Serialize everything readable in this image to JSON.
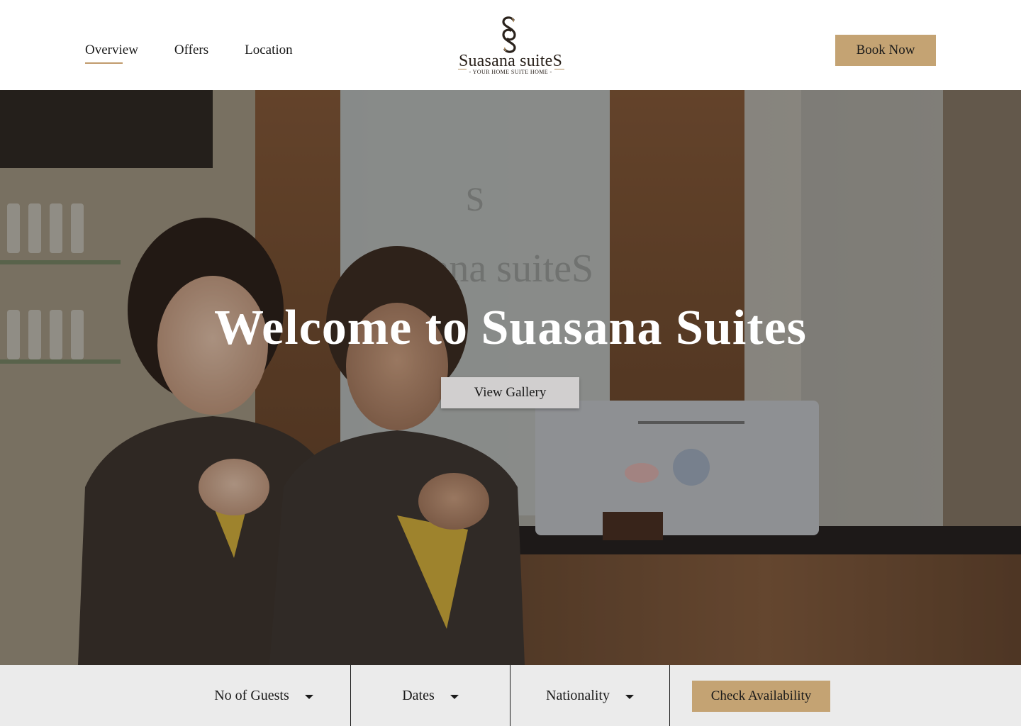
{
  "header": {
    "nav": [
      {
        "label": "Overview",
        "active": true
      },
      {
        "label": "Offers",
        "active": false
      },
      {
        "label": "Location",
        "active": false
      }
    ],
    "logo": {
      "name": "Suasana suiteS",
      "tagline": "- YOUR HOME SUITE HOME -",
      "icon": "section-sign-icon"
    },
    "book_now_label": "Book Now"
  },
  "hero": {
    "title": "Welcome to Suasana Suites",
    "gallery_button_label": "View Gallery",
    "background": "photo of two smiling hotel receptionists at front desk"
  },
  "booking": {
    "guests_label": "No of Guests",
    "dates_label": "Dates",
    "nationality_label": "Nationality",
    "check_label": "Check Availability"
  },
  "colors": {
    "accent": "#c4a373",
    "underline": "#c19b6c",
    "booking_bar_bg": "#ebebeb",
    "gallery_btn_bg": "#d1cfcf"
  }
}
